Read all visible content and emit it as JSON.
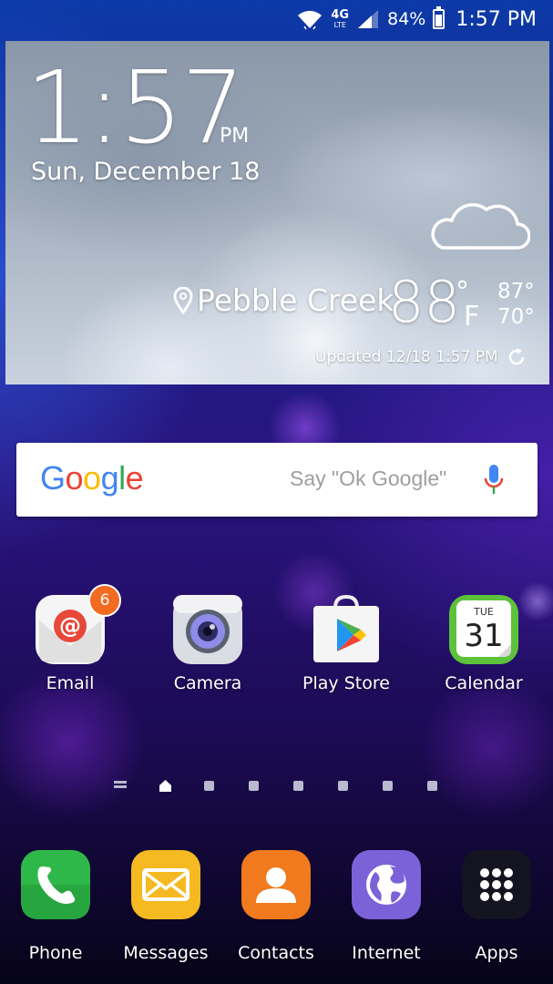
{
  "status_bar": {
    "network": "4G",
    "network_sub": "LTE",
    "battery": "84%",
    "battery_level": 0.84,
    "time": "1:57 PM",
    "icons": [
      "wifi-icon",
      "lte-icon",
      "signal-icon",
      "battery-icon"
    ]
  },
  "widget": {
    "time": "1:57",
    "ampm": "PM",
    "date": "Sun, December 18",
    "location": "Pebble Creek",
    "temperature": "88",
    "degree": "°",
    "unit": "F",
    "high": "87°",
    "low": "70°",
    "updated": "Updated 12/18 1:57 PM",
    "condition_icon": "cloud-icon"
  },
  "search": {
    "logo_letters": [
      {
        "char": "G",
        "color": "#4285F4"
      },
      {
        "char": "o",
        "color": "#EA4335"
      },
      {
        "char": "o",
        "color": "#FBBC05"
      },
      {
        "char": "g",
        "color": "#4285F4"
      },
      {
        "char": "l",
        "color": "#34A853"
      },
      {
        "char": "e",
        "color": "#EA4335"
      }
    ],
    "hint": "Say \"Ok Google\""
  },
  "apps": [
    {
      "label": "Email",
      "badge": "6"
    },
    {
      "label": "Camera"
    },
    {
      "label": "Play Store"
    },
    {
      "label": "Calendar",
      "day": "TUE",
      "date": "31"
    }
  ],
  "page_indicator": {
    "pages": 7,
    "current": "home"
  },
  "dock": [
    {
      "label": "Phone"
    },
    {
      "label": "Messages"
    },
    {
      "label": "Contacts"
    },
    {
      "label": "Internet"
    },
    {
      "label": "Apps"
    }
  ],
  "colors": {
    "email_badge": "#f26b21",
    "phone": "#2fb84a",
    "messages": "#f5b921",
    "contacts": "#f07a1d",
    "internet": "#7b62d8"
  }
}
